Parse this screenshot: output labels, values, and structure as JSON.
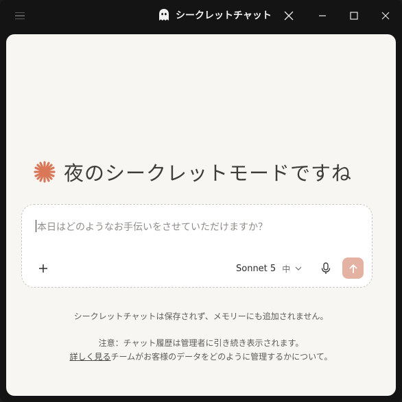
{
  "window": {
    "title": "シークレットチャット"
  },
  "main": {
    "greeting": "夜のシークレットモードですね"
  },
  "composer": {
    "placeholder": "本日はどのようなお手伝いをさせていただけますか？",
    "model_name": "Sonnet 5",
    "effort": "中"
  },
  "footer": {
    "notice": "シークレットチャットは保存されず、メモリーにも追加されません。",
    "caution": "注意：チャット履歴は管理者に引き続き表示されます。",
    "learn_more": "詳しく見る",
    "learn_more_rest": "チームがお客様のデータをどのように管理するかについて。"
  },
  "colors": {
    "accent": "#d97757",
    "send_button": "#e4b2a2",
    "panel_bg": "#f7f6f3",
    "window_bg": "#141414"
  },
  "icons": [
    "menu-icon",
    "ghost-icon",
    "close-icon",
    "minimize-icon",
    "maximize-icon",
    "sparkle-icon",
    "plus-icon",
    "chevron-down-icon",
    "microphone-icon",
    "arrow-up-icon"
  ]
}
